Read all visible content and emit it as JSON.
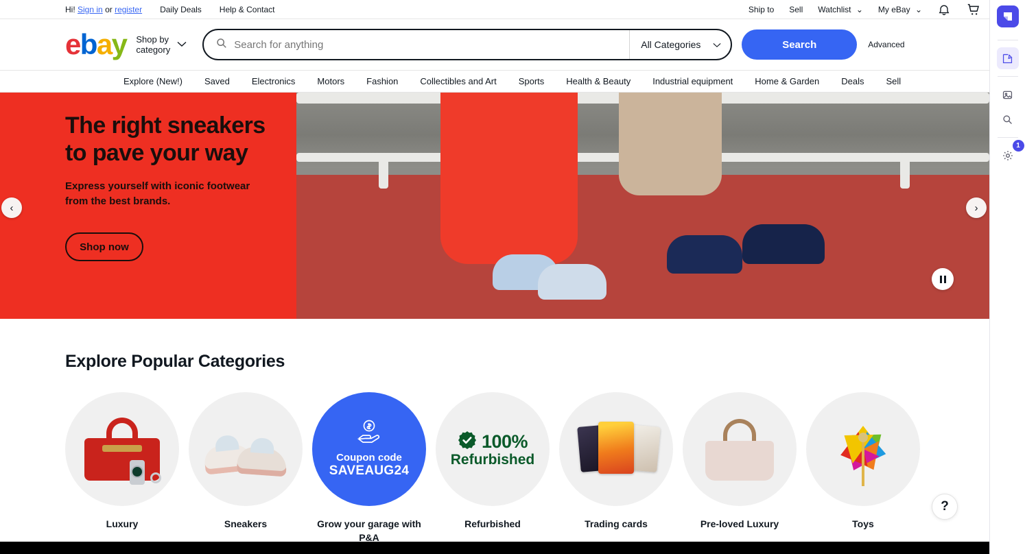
{
  "utility_bar": {
    "greeting": "Hi!",
    "signin": "Sign in",
    "or": "or",
    "register": "register",
    "daily_deals": "Daily Deals",
    "help_contact": "Help & Contact",
    "ship_to": "Ship to",
    "sell": "Sell",
    "watchlist": "Watchlist",
    "my_ebay": "My eBay",
    "caret": "⌄",
    "notifications_icon": "bell-icon",
    "cart_icon": "cart-icon"
  },
  "header": {
    "logo": {
      "e": "e",
      "b": "b",
      "a": "a",
      "y": "y"
    },
    "shop_by_line1": "Shop by",
    "shop_by_line2": "category",
    "search_placeholder": "Search for anything",
    "search_value": "",
    "category_selected": "All Categories",
    "search_button": "Search",
    "advanced": "Advanced"
  },
  "nav": {
    "items": [
      "Explore (New!)",
      "Saved",
      "Electronics",
      "Motors",
      "Fashion",
      "Collectibles and Art",
      "Sports",
      "Health & Beauty",
      "Industrial equipment",
      "Home & Garden",
      "Deals",
      "Sell"
    ]
  },
  "hero": {
    "title": "The right sneakers to pave your way",
    "subtitle": "Express yourself with iconic footwear from the best brands.",
    "cta": "Shop now",
    "prev_arrow": "‹",
    "next_arrow": "›",
    "bg_color": "#ee2f22"
  },
  "categories": {
    "heading": "Explore Popular Categories",
    "items": [
      {
        "label": "Luxury",
        "art": "luxury-bag"
      },
      {
        "label": "Sneakers",
        "art": "sneakers"
      },
      {
        "label": "Grow your garage with P&A",
        "art": "coupon",
        "coupon_label": "Coupon code",
        "coupon_code": "SAVEAUG24"
      },
      {
        "label": "Refurbished",
        "art": "refurbished",
        "refurb_percent": "100%",
        "refurb_word": "Refurbished"
      },
      {
        "label": "Trading cards",
        "art": "trading-cards"
      },
      {
        "label": "Pre-loved Luxury",
        "art": "tote-bag"
      },
      {
        "label": "Toys",
        "art": "pinwheel"
      }
    ]
  },
  "help": {
    "label": "?"
  },
  "rail": {
    "logo_icon": "app-logo-icon",
    "items": [
      {
        "icon": "edit-pen-icon",
        "active": true,
        "badge": ""
      },
      {
        "icon": "image-icon",
        "active": false,
        "badge": ""
      },
      {
        "icon": "search-icon",
        "active": false,
        "badge": ""
      },
      {
        "icon": "gear-icon",
        "active": false,
        "badge": "1"
      }
    ]
  },
  "colors": {
    "ebay_blue": "#3665f3",
    "hero_red": "#ee2f22",
    "refurb_green": "#0b5a2a",
    "rail_purple": "#4b4ae8"
  }
}
